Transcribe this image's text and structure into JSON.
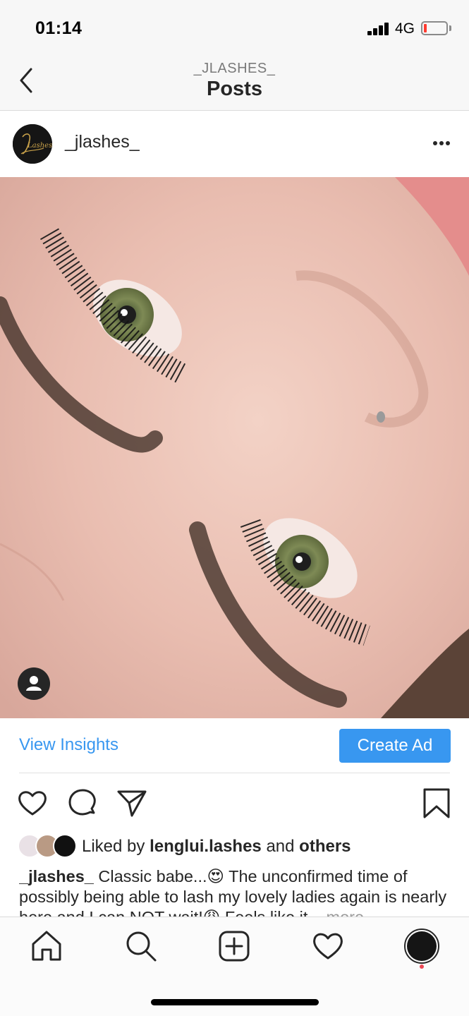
{
  "status_bar": {
    "time": "01:14",
    "network": "4G"
  },
  "nav": {
    "subtitle": "_JLASHES_",
    "title": "Posts"
  },
  "post": {
    "username": "_jlashes_",
    "avatar_logo_text": "Lashes",
    "insights_label": "View Insights",
    "create_ad_label": "Create Ad",
    "likes": {
      "prefix": "Liked by ",
      "user": "lenglui.lashes",
      "joiner": " and ",
      "others": "others"
    },
    "caption": {
      "user": "_jlashes_",
      "text": " Classic babe...😍 The unconfirmed time of possibly being able to lash my lovely ladies again is nearly here and I can NOT wait!😩 Feels like it",
      "more": "... more"
    }
  },
  "icons": {
    "back": "chevron-left-icon",
    "more": "more-horizontal-icon",
    "tag": "user-tag-icon",
    "like": "heart-icon",
    "comment": "comment-icon",
    "share": "paper-plane-icon",
    "save": "bookmark-icon",
    "home": "home-icon",
    "search": "search-icon",
    "add": "plus-square-icon",
    "activity": "heart-icon",
    "profile": "avatar"
  },
  "colors": {
    "accent": "#3897f0",
    "text": "#262626",
    "muted": "#999999",
    "notification": "#ed4956",
    "battery_low": "#ff3b30"
  }
}
